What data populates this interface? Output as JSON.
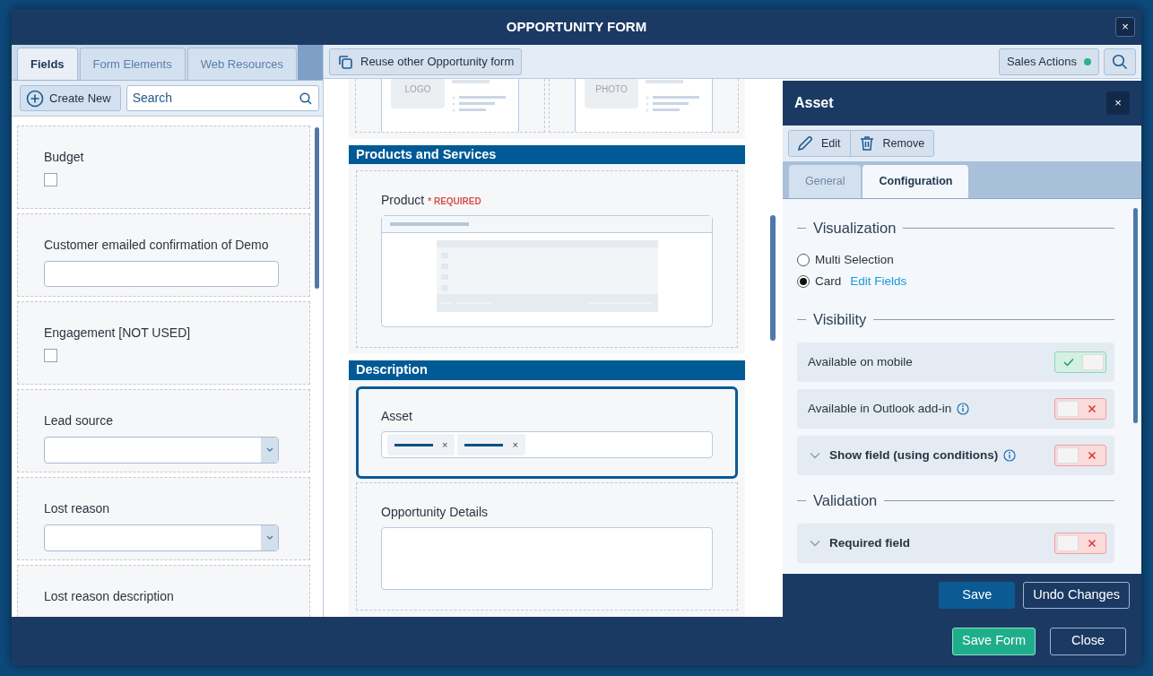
{
  "window": {
    "title": "OPPORTUNITY FORM",
    "close": "×"
  },
  "fields_panel": {
    "tabs": [
      {
        "label": "Fields",
        "selected": true
      },
      {
        "label": "Form Elements",
        "selected": false
      },
      {
        "label": "Web Resources",
        "selected": false
      }
    ],
    "create_button": "Create New",
    "search": {
      "placeholder": "Search"
    },
    "fields": [
      {
        "label": "Budget",
        "kind": "checkbox",
        "checked": false
      },
      {
        "label": "Customer emailed confirmation of Demo",
        "kind": "text"
      },
      {
        "label": "Engagement [NOT USED]",
        "kind": "checkbox",
        "checked": false
      },
      {
        "label": "Lead source",
        "kind": "dropdown"
      },
      {
        "label": "Lost reason",
        "kind": "dropdown"
      },
      {
        "label": "Lost reason description",
        "kind": "label"
      }
    ]
  },
  "toolbar": {
    "reuse_button": "Reuse other Opportunity form",
    "sales_actions": "Sales Actions"
  },
  "canvas": {
    "image_cards": [
      {
        "placeholder": "LOGO"
      },
      {
        "placeholder": "PHOTO"
      }
    ],
    "sections": [
      {
        "title": "Products and Services",
        "fields": [
          {
            "label": "Product",
            "required": "* REQUIRED",
            "kind": "grid",
            "selected": false
          }
        ]
      },
      {
        "title": "Description",
        "fields": [
          {
            "label": "Asset",
            "kind": "tags",
            "selected": true,
            "tags": [
              {
                "remove": "×"
              },
              {
                "remove": "×"
              }
            ]
          },
          {
            "label": "Opportunity Details",
            "kind": "textarea",
            "selected": false
          }
        ]
      }
    ]
  },
  "properties_panel": {
    "title": "Asset",
    "close": "×",
    "actions": [
      {
        "kind": "edit",
        "label": "Edit"
      },
      {
        "kind": "remove",
        "label": "Remove"
      }
    ],
    "tabs": [
      {
        "label": "General",
        "selected": false
      },
      {
        "label": "Configuration",
        "selected": true
      }
    ],
    "sections": [
      {
        "title": "Visualization",
        "kind": "options",
        "options": [
          {
            "label": "Multi Selection",
            "selected": false
          },
          {
            "label": "Card",
            "selected": true,
            "link": "Edit Fields"
          }
        ]
      },
      {
        "title": "Visibility",
        "kind": "toggles",
        "rows": [
          {
            "label": "Available on mobile",
            "on": true,
            "info": false,
            "expandable": false
          },
          {
            "label": "Available in Outlook add-in",
            "on": false,
            "info": true,
            "expandable": false
          },
          {
            "label": "Show field (using conditions)",
            "on": false,
            "info": true,
            "expandable": true
          }
        ]
      },
      {
        "title": "Validation",
        "kind": "toggles",
        "rows": [
          {
            "label": "Required field",
            "on": false,
            "info": false,
            "expandable": true
          }
        ]
      }
    ],
    "save_button": "Save",
    "undo_button": "Undo Changes"
  },
  "footer": {
    "save_button": "Save Form",
    "close_button": "Close"
  }
}
